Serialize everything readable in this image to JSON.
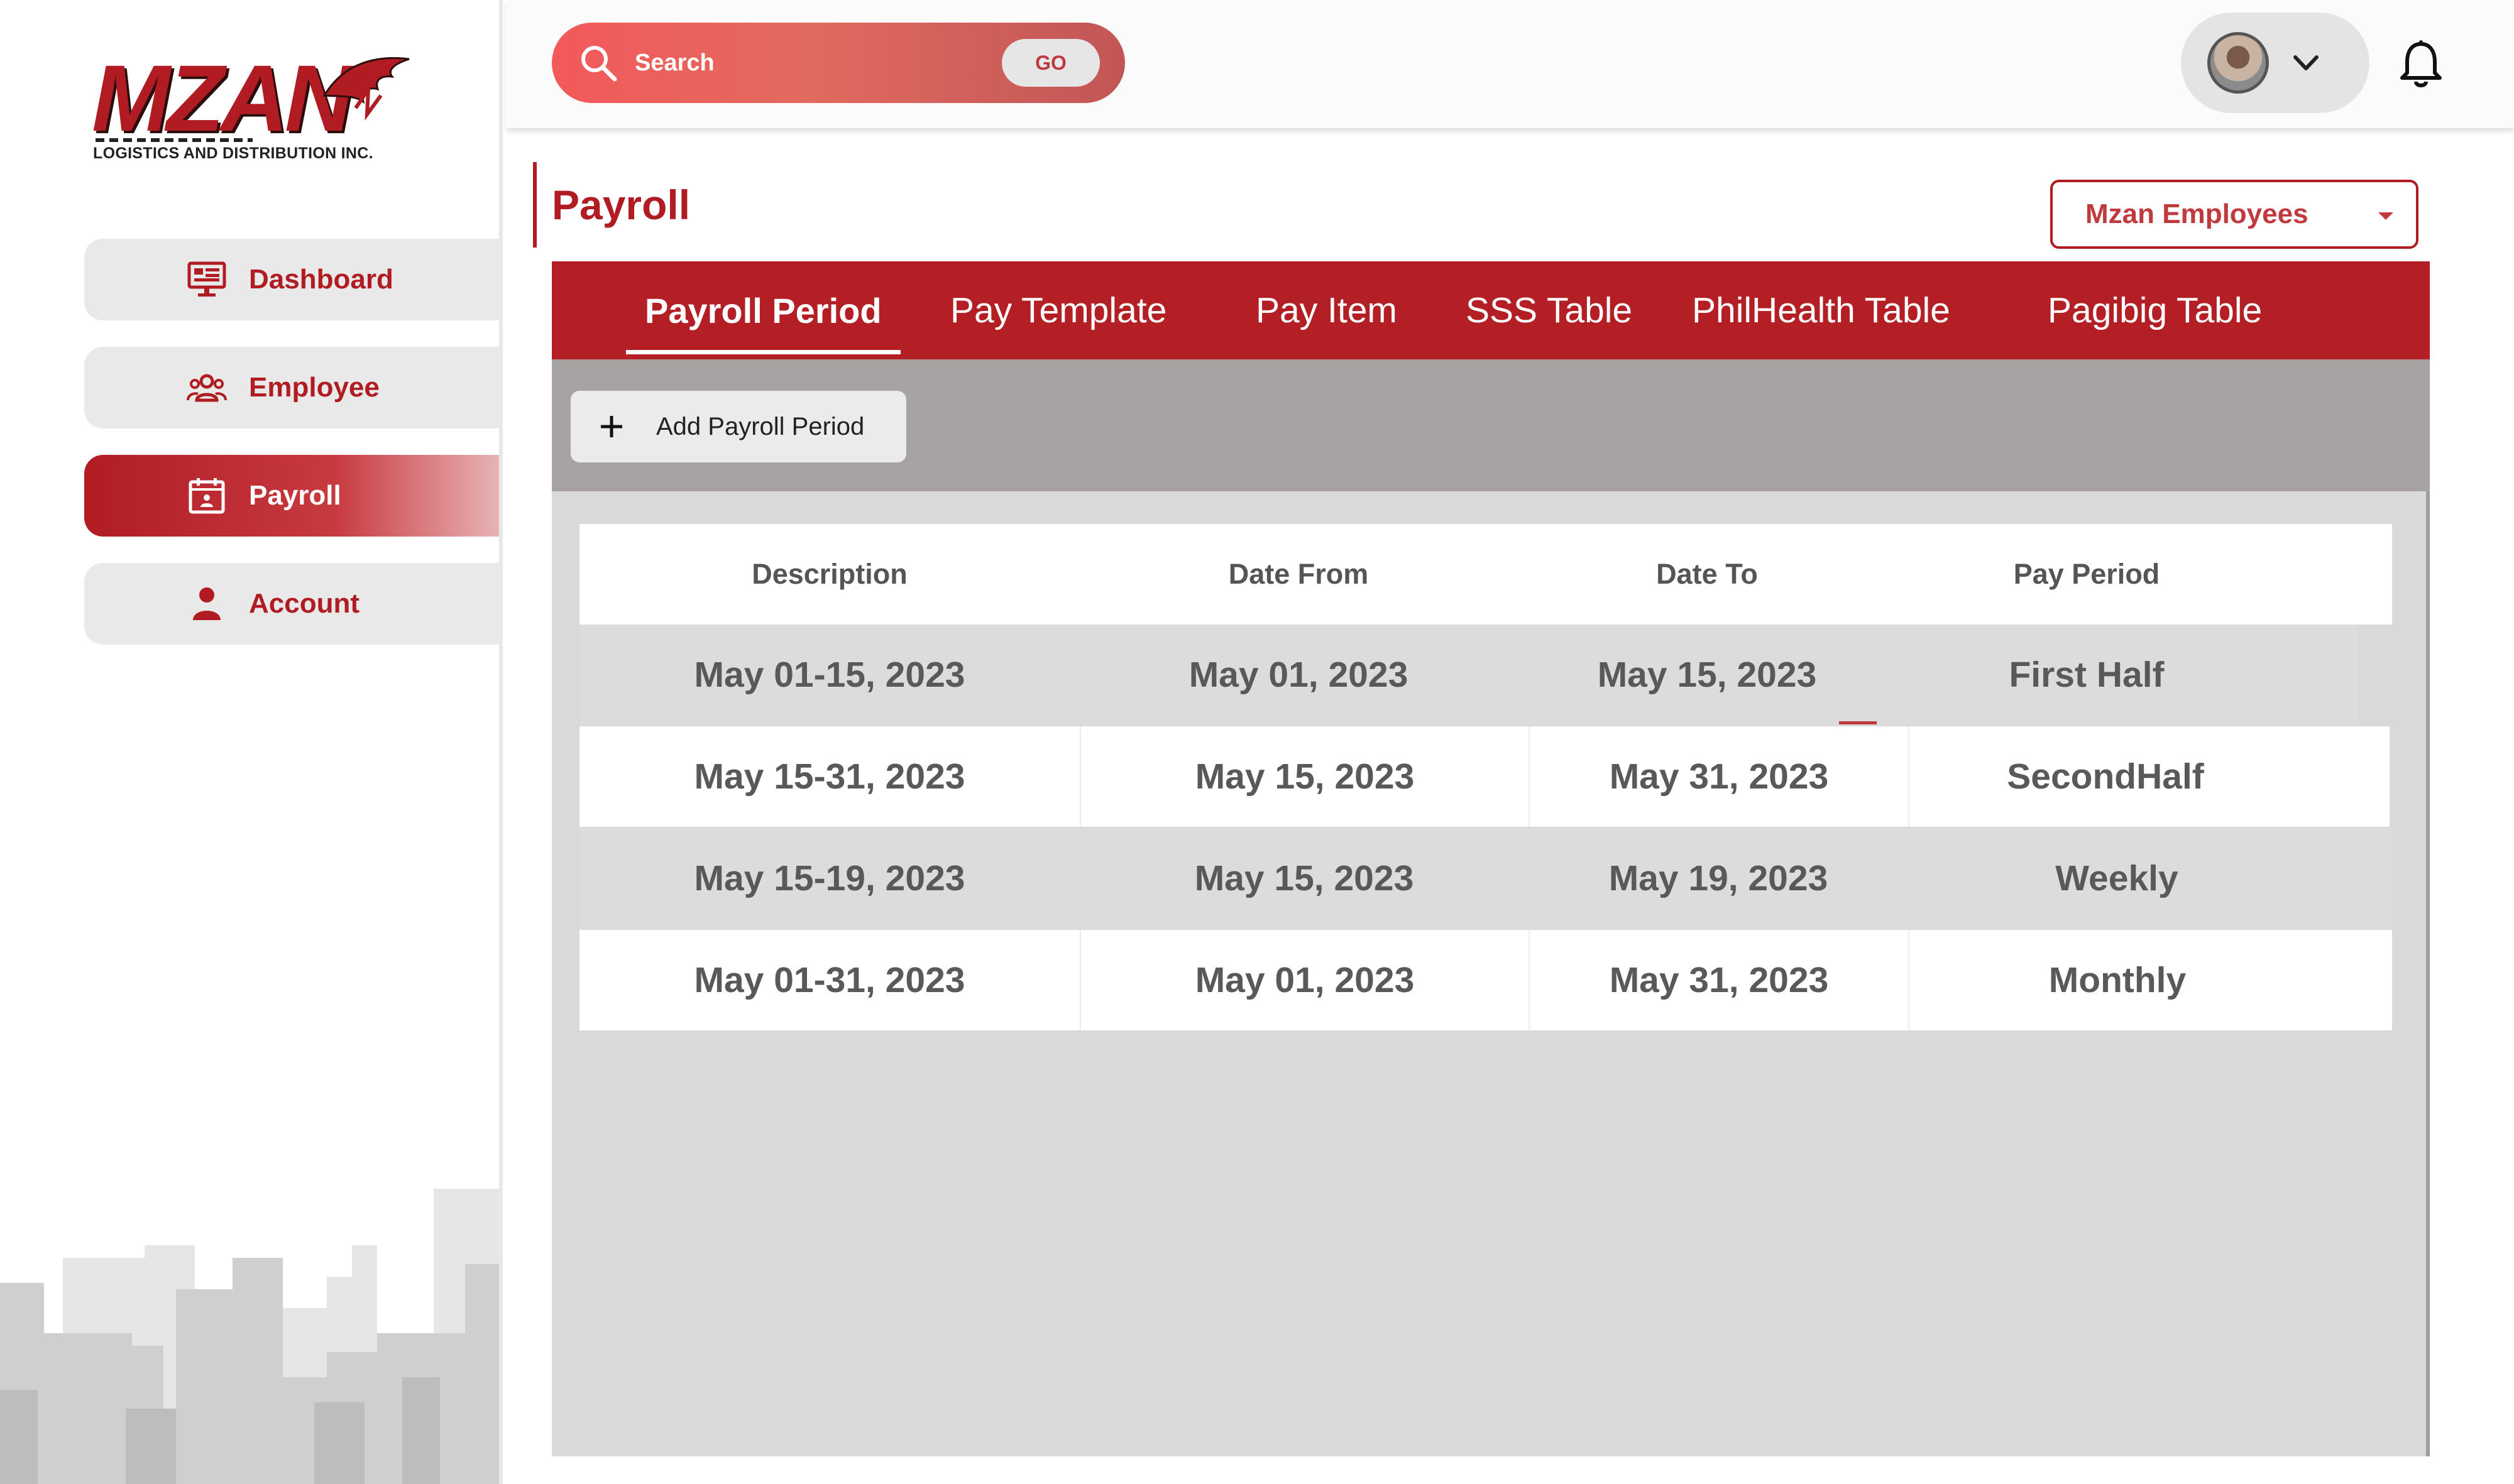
{
  "brand": {
    "logo_word": "MZAN",
    "logo_subtitle": "LOGISTICS AND DISTRIBUTION INC.",
    "primary_color": "#b01c22"
  },
  "sidebar": {
    "items": [
      {
        "label": "Dashboard",
        "icon": "monitor-icon",
        "active": false
      },
      {
        "label": "Employee",
        "icon": "users-icon",
        "active": false
      },
      {
        "label": "Payroll",
        "icon": "calendar-user-icon",
        "active": true
      },
      {
        "label": "Account",
        "icon": "user-icon",
        "active": false
      }
    ]
  },
  "header": {
    "search_placeholder": "Search",
    "go_label": "GO"
  },
  "page": {
    "title": "Payroll",
    "company_select": "Mzan Employees"
  },
  "tabs": [
    {
      "label": "Payroll Period",
      "active": true
    },
    {
      "label": "Pay Template",
      "active": false
    },
    {
      "label": "Pay Item",
      "active": false
    },
    {
      "label": "SSS Table",
      "active": false
    },
    {
      "label": "PhilHealth Table",
      "active": false
    },
    {
      "label": "Pagibig Table",
      "active": false
    }
  ],
  "toolbar": {
    "add_label": "Add Payroll Period"
  },
  "table": {
    "columns": [
      "Description",
      "Date From",
      "Date To",
      "Pay Period"
    ],
    "rows": [
      [
        "May 01-15, 2023",
        "May 01, 2023",
        "May 15, 2023",
        "First Half"
      ],
      [
        "May 15-31, 2023",
        "May 15, 2023",
        "May 31, 2023",
        "SecondHalf"
      ],
      [
        "May 15-19, 2023",
        "May 15, 2023",
        "May 19, 2023",
        "Weekly"
      ],
      [
        "May 01-31, 2023",
        "May 01, 2023",
        "May 31, 2023",
        "Monthly"
      ]
    ]
  }
}
